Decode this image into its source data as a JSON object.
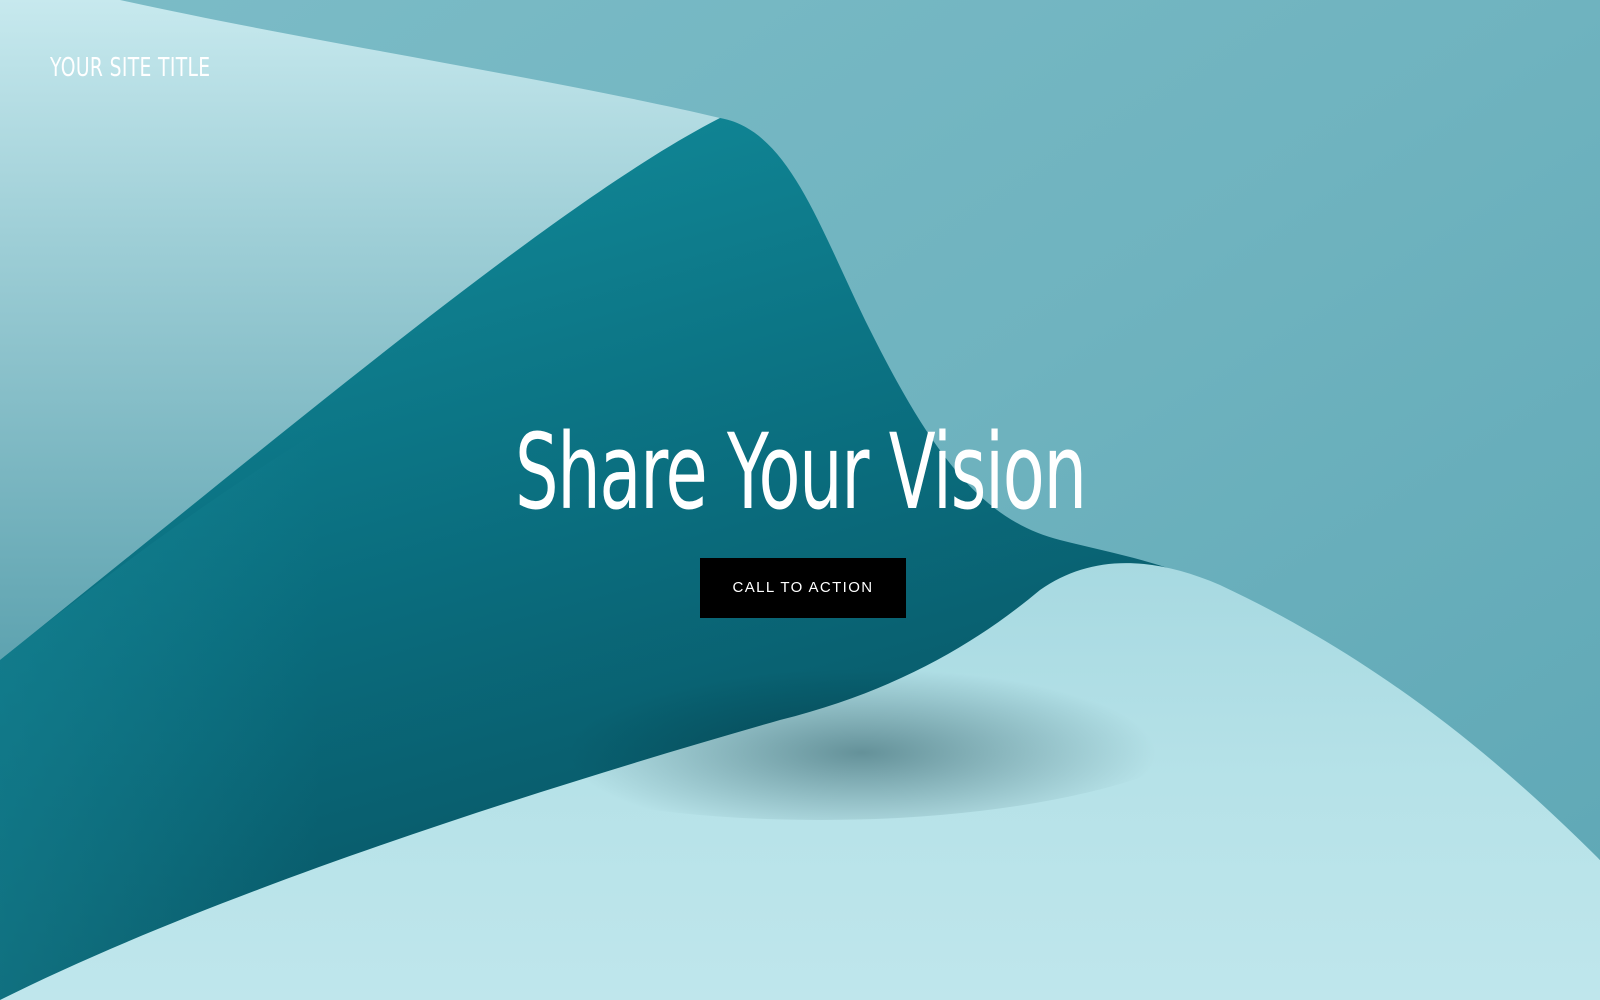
{
  "header": {
    "site_title": "YOUR SITE TITLE"
  },
  "hero": {
    "headline": "Share Your Vision",
    "cta_label": "CALL TO ACTION",
    "background": "teal-curved-paper-image"
  },
  "colors": {
    "text": "#ffffff",
    "button_bg": "#000000",
    "button_text": "#ffffff",
    "accent_teal": "#0e7f8f",
    "light_teal": "#b8e3ea"
  }
}
